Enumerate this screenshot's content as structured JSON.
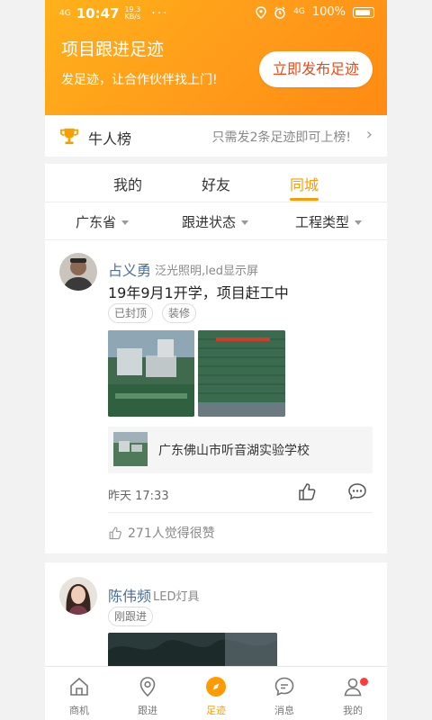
{
  "status_bar": {
    "signal": "4G",
    "time": "10:47",
    "speed": "19.3",
    "speed_unit": "KB/s",
    "dots": "···",
    "network_right": "4G",
    "battery": "100%"
  },
  "header": {
    "title": "项目跟进足迹",
    "subtitle": "发足迹，让合作伙伴找上门!",
    "publish_button": "立即发布足迹",
    "colors": {
      "primary": "#ff9a00",
      "accent": "#e84b1a"
    }
  },
  "rank": {
    "title": "牛人榜",
    "hint": "只需发2条足迹即可上榜!"
  },
  "tabs": [
    {
      "label": "我的"
    },
    {
      "label": "好友"
    },
    {
      "label": "同城"
    }
  ],
  "filters": [
    {
      "label": "广东省"
    },
    {
      "label": "跟进状态"
    },
    {
      "label": "工程类型"
    }
  ],
  "posts": [
    {
      "name": "占义勇",
      "tag": "泛光照明,led显示屏",
      "text": "19年9月1开学，项目赶工中",
      "chips": [
        "已封顶",
        "装修"
      ],
      "location": "广东佛山市听音湖实验学校",
      "time": "昨天  17:33",
      "likes": "271人觉得很赞"
    },
    {
      "name": "陈伟频",
      "tag": "LED灯具",
      "chips": [
        "刚跟进"
      ]
    }
  ],
  "bottom_nav": [
    {
      "label": "商机",
      "icon": "home-icon"
    },
    {
      "label": "跟进",
      "icon": "location-pin-icon"
    },
    {
      "label": "足迹",
      "icon": "compass-icon"
    },
    {
      "label": "消息",
      "icon": "message-icon"
    },
    {
      "label": "我的",
      "icon": "user-icon"
    }
  ]
}
